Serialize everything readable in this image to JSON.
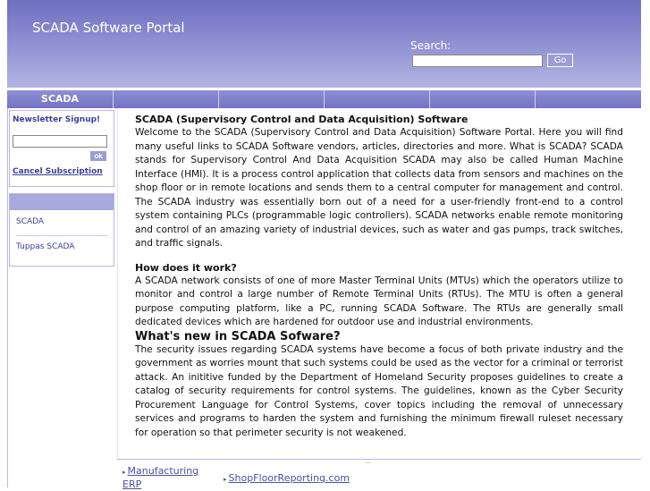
{
  "header": {
    "site_title": "SCADA Software Portal",
    "search_label": "Search:",
    "search_value": "",
    "go_label": "Go"
  },
  "nav": {
    "items": [
      "SCADA",
      "",
      "",
      "",
      "",
      ""
    ]
  },
  "sidebar": {
    "newsletter_title": "Newsletter Signup!",
    "email_value": "",
    "ok_label": "ok",
    "cancel_label": "Cancel Subscription",
    "links": [
      "SCADA",
      "Tuppas SCADA"
    ]
  },
  "article": {
    "title": "SCADA (Supervisory Control and Data Acquisition) Software",
    "intro": "Welcome to the SCADA (Supervisory Control and Data Acquisition) Software Portal. Here you will find many useful links to SCADA Software vendors, articles, directories and more. What is SCADA? SCADA stands for Supervisory Control And Data Acquisition SCADA may also be called Human Machine Interface (HMI). It is a process control application that collects data from sensors and machines on the shop floor or in remote locations and sends them to a central computer for management and control. The SCADA industry was essentially born out of a need for a user-friendly front-end to a control system containing PLCs (programmable logic controllers). SCADA networks enable remote monitoring and control of an amazing variety of industrial devices, such as water and gas pumps, track switches, and traffic signals.",
    "how_heading": "How does it work?",
    "how_text": "A SCADA network consists of one of more Master Terminal Units (MTUs) which the operators utilize to monitor and control a large number of Remote Terminal Units (RTUs). The MTU is often a general purpose computing platform, like a PC, running SCADA Software. The RTUs are generally small dedicated devices which are hardened for outdoor use and industrial environments.",
    "new_heading": "What's new in SCADA Sofware?",
    "new_text": "The security issues regarding SCADA systems have become a focus of both private industry and the government as worries mount that such systems could be used as the vector for a criminal or terrorist attack. An inititive funded by the Department of Homeland Security proposes guidelines to create a catalog of security requirements for control systems. The guidelines, known as the Cyber Security Procurement Language for Control Systems, cover topics including the removal of unnecessary services and programs to harden the system and furnishing the minimum firewall ruleset necessary for operation so that perimeter security is not weakened."
  },
  "footer": {
    "links": [
      "Manufacturing ERP",
      "ShopFloorReporting.com"
    ]
  }
}
